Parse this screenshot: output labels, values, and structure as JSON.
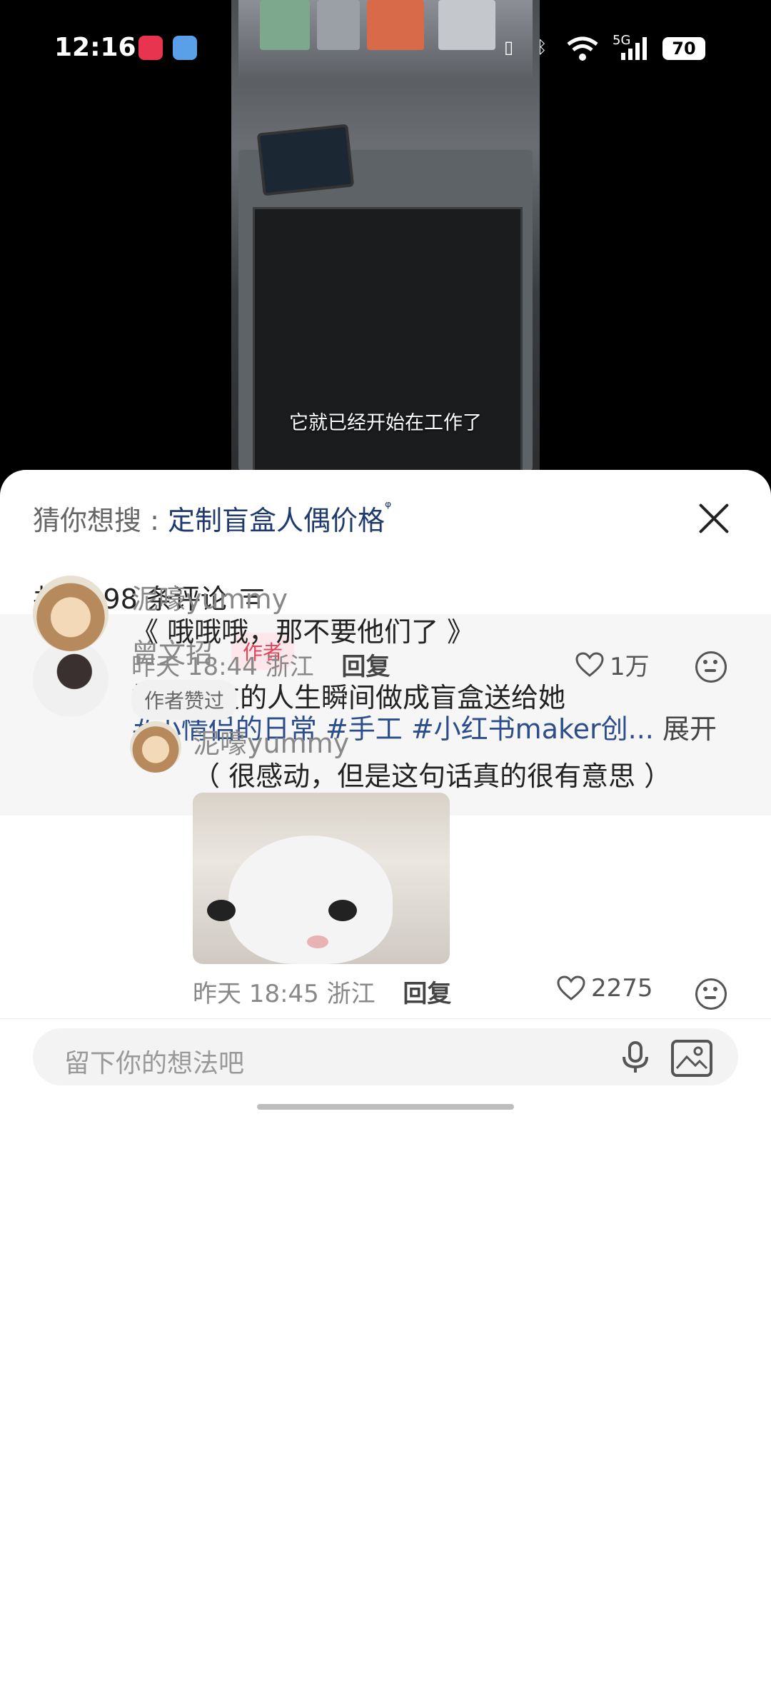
{
  "status_bar": {
    "time": "12:16",
    "network": "5G",
    "battery": "70",
    "icons": [
      "app-icon-1",
      "weather-icon",
      "vibrate-icon",
      "bluetooth-icon",
      "wifi-icon",
      "signal-icon"
    ]
  },
  "video": {
    "subtitle": "它就已经开始在工作了"
  },
  "sheet": {
    "guess_prefix": "猜你想搜 : ",
    "guess_query": "定制盲盒人偶价格",
    "comment_count": "共 1598 条评论",
    "author_post": {
      "name": "曾文招",
      "tag": "作者",
      "text": "把女朋友的人生瞬间做成盲盒送给她",
      "hashtags": "#小情侣的日常 #手工 #小红书maker创...",
      "expand": "展开"
    },
    "comments": [
      {
        "name": "泥嚎yummy",
        "text": "《 哦哦哦，那不要他们了 》",
        "time": "昨天 18:44",
        "location": "浙江",
        "reply_label": "回复",
        "likes": "1万",
        "badge": "作者赞过",
        "reply": {
          "name": "泥嚎yummy",
          "text": "（ 很感动，但是这句话真的很有意思 ）",
          "time": "昨天 18:45",
          "location": "浙江",
          "reply_label": "回复",
          "likes": "2275"
        }
      }
    ],
    "input_placeholder": "留下你的想法吧"
  },
  "colors": {
    "hashtag": "#2b4d8c",
    "author_tag_text": "#e0455b",
    "author_tag_bg": "#fde7ea"
  }
}
